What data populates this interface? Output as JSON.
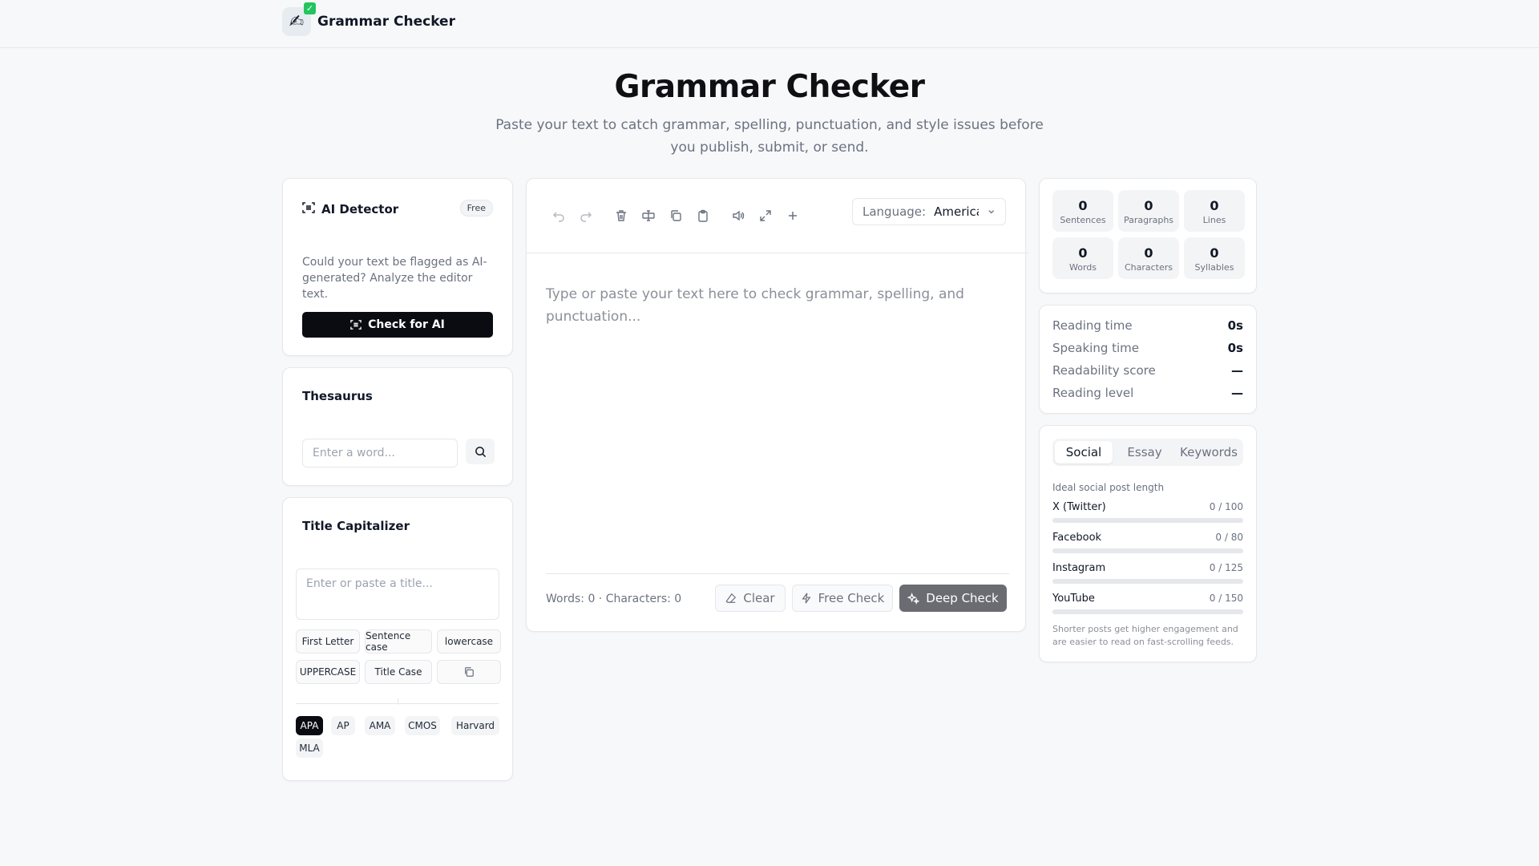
{
  "app": {
    "name": "Grammar Checker"
  },
  "hero": {
    "title": "Grammar Checker",
    "subtitle": "Paste your text to catch grammar, spelling, punctuation, and style issues before you publish, submit, or send."
  },
  "ai_detector": {
    "title": "AI Detector",
    "badge": "Free",
    "description": "Could your text be flagged as AI-generated? Analyze the editor text.",
    "button": "Check for AI"
  },
  "thesaurus": {
    "title": "Thesaurus",
    "placeholder": "Enter a word..."
  },
  "title_capitalizer": {
    "title": "Title Capitalizer",
    "placeholder": "Enter or paste a title...",
    "buttons": [
      "First Letter",
      "Sentence case",
      "lowercase",
      "UPPERCASE",
      "Title Case"
    ],
    "styles": [
      "APA",
      "AP",
      "AMA",
      "CMOS",
      "Harvard",
      "MLA"
    ],
    "active_style": "APA"
  },
  "editor": {
    "language_label": "Language:",
    "language_value": "American",
    "placeholder": "Type or paste your text here to check grammar, spelling, and punctuation...",
    "counts": "Words: 0 · Characters: 0",
    "clear": "Clear",
    "free_check": "Free Check",
    "deep_check": "Deep Check"
  },
  "stats": [
    {
      "value": "0",
      "label": "Sentences"
    },
    {
      "value": "0",
      "label": "Paragraphs"
    },
    {
      "value": "0",
      "label": "Lines"
    },
    {
      "value": "0",
      "label": "Words"
    },
    {
      "value": "0",
      "label": "Characters"
    },
    {
      "value": "0",
      "label": "Syllables"
    }
  ],
  "metrics": [
    {
      "label": "Reading time",
      "value": "0s"
    },
    {
      "label": "Speaking time",
      "value": "0s"
    },
    {
      "label": "Readability score",
      "value": "—"
    },
    {
      "label": "Reading level",
      "value": "—"
    }
  ],
  "social": {
    "tabs": [
      "Social",
      "Essay",
      "Keywords"
    ],
    "active_tab": "Social",
    "heading": "Ideal social post length",
    "platforms": [
      {
        "name": "X (Twitter)",
        "value": "0 / 100",
        "progress": 0
      },
      {
        "name": "Facebook",
        "value": "0 / 80",
        "progress": 0
      },
      {
        "name": "Instagram",
        "value": "0 / 125",
        "progress": 0
      },
      {
        "name": "YouTube",
        "value": "0 / 150",
        "progress": 0
      }
    ],
    "note": "Shorter posts get higher engagement and are easier to read on fast-scrolling feeds."
  }
}
